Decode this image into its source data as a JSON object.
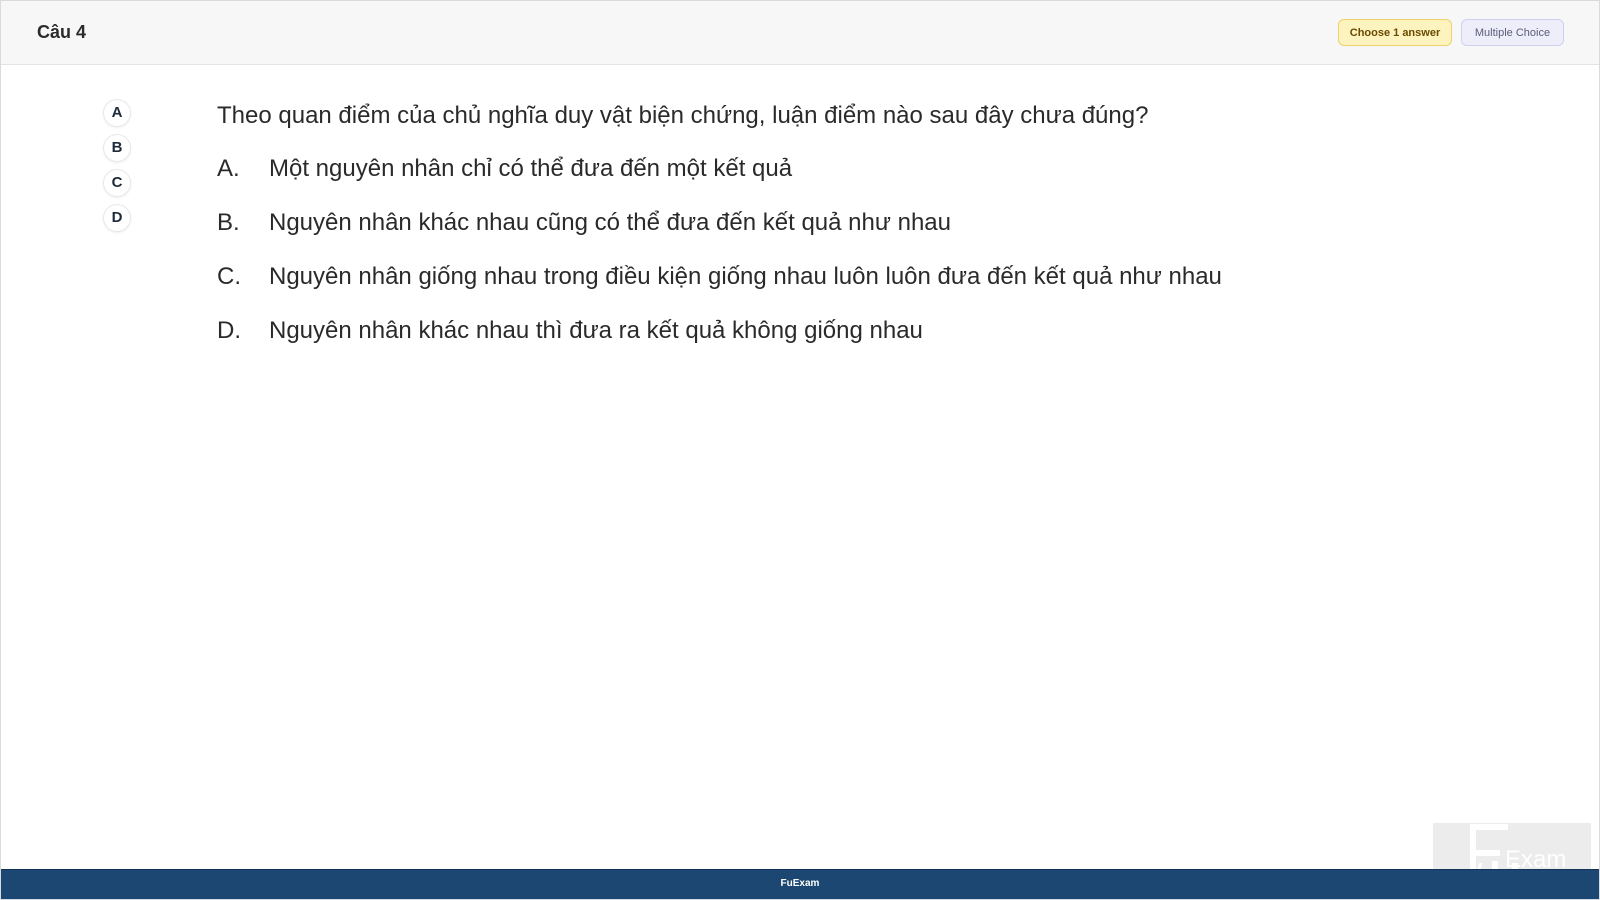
{
  "header": {
    "question_title": "Câu 4",
    "badge_choose": "Choose 1 answer",
    "badge_type": "Multiple Choice"
  },
  "answer_circles": [
    "A",
    "B",
    "C",
    "D"
  ],
  "question": {
    "text": "Theo quan điểm của chủ nghĩa duy vật biện chứng, luận điểm nào sau đây chưa đúng?",
    "options": [
      {
        "letter": "A.",
        "text": "Một nguyên nhân chỉ có thể đưa đến một kết quả"
      },
      {
        "letter": "B.",
        "text": "Nguyên nhân khác nhau cũng có thể đưa đến kết quả như nhau"
      },
      {
        "letter": "C.",
        "text": "Nguyên nhân giống nhau trong điều kiện giống nhau luôn luôn đưa đến kết quả như nhau"
      },
      {
        "letter": "D.",
        "text": "Nguyên nhân khác nhau thì đưa ra kết quả không giống nhau"
      }
    ]
  },
  "footer": {
    "label": "FuExam"
  },
  "watermark": {
    "logo_text": "Exam",
    "logo_letters": "FU"
  },
  "colors": {
    "footer_bg": "#1c4772",
    "badge_choose_bg": "#fdf3bf",
    "badge_type_bg": "#eeeefb"
  }
}
